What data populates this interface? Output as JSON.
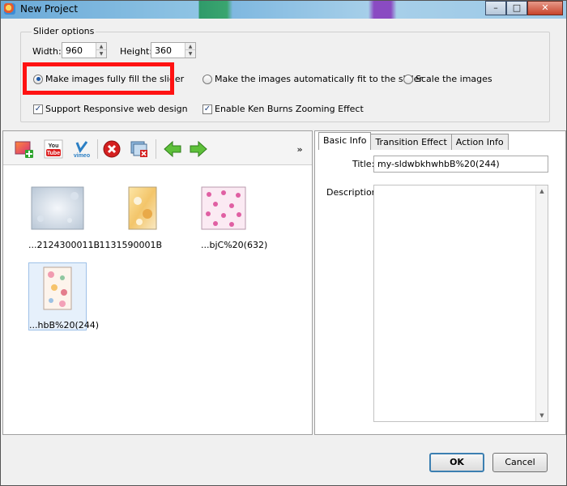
{
  "window": {
    "title": "New Project",
    "minimize": "–",
    "maximize": "□",
    "close": "✕"
  },
  "options": {
    "legend": "Slider options",
    "width_label": "Width:",
    "width_value": "960",
    "height_label": "Height:",
    "height_value": "360",
    "radio_fill": "Make images fully fill the slider",
    "radio_fit": "Make the images automatically fit to the slider",
    "radio_scale": "Scale the images",
    "check_responsive": "Support Responsive web design",
    "check_kenburns": "Enable Ken Burns Zooming Effect"
  },
  "toolbar": {
    "youtube_line1": "You",
    "youtube_line2": "Tube",
    "vimeo": "vimeo",
    "more": "»"
  },
  "thumbnails": [
    {
      "caption": "...2124300011B"
    },
    {
      "caption": "...1131590001B"
    },
    {
      "caption": "...bjC%20(632)"
    },
    {
      "caption": "...hbB%20(244)"
    }
  ],
  "tabs": {
    "basic": "Basic Info",
    "transition": "Transition Effect",
    "action": "Action Info"
  },
  "basic_info": {
    "title_label": "Title:",
    "title_value": "my-sldwbkhwhbB%20(244)",
    "description_label": "Description:"
  },
  "buttons": {
    "ok": "OK",
    "cancel": "Cancel"
  },
  "colors": {
    "highlight": "#ff1212",
    "accent": "#3c7fb1"
  }
}
